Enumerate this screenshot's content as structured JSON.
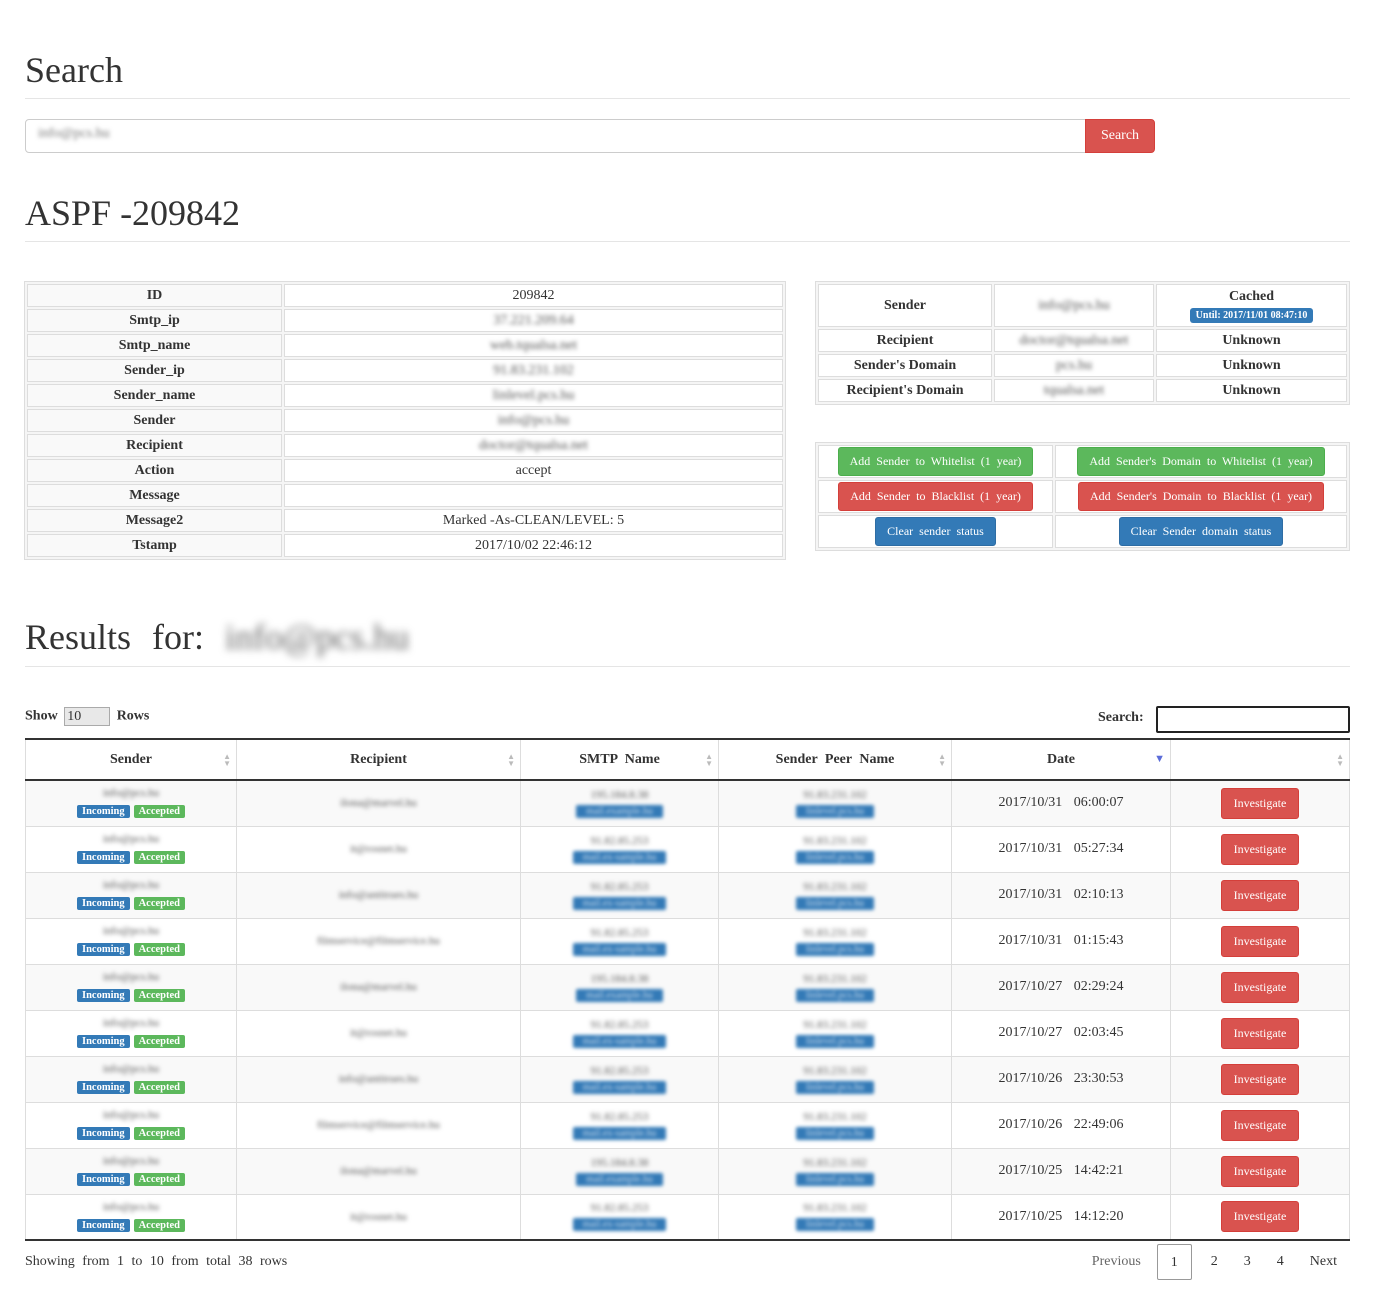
{
  "search": {
    "title": "Search",
    "input_value": "info@pcs.hu",
    "button_label": "Search"
  },
  "record": {
    "title": "ASPF -209842",
    "fields": [
      {
        "key": "ID",
        "value": "209842",
        "blurred": false
      },
      {
        "key": "Smtp_ip",
        "value": "37.221.209.64",
        "blurred": true
      },
      {
        "key": "Smtp_name",
        "value": "web.tqualsa.net",
        "blurred": true
      },
      {
        "key": "Sender_ip",
        "value": "91.83.231.102",
        "blurred": true
      },
      {
        "key": "Sender_name",
        "value": "linlevel.pcs.hu",
        "blurred": true
      },
      {
        "key": "Sender",
        "value": "info@pcs.hu",
        "blurred": true
      },
      {
        "key": "Recipient",
        "value": "doctor@tqualsa.net",
        "blurred": true
      },
      {
        "key": "Action",
        "value": "accept",
        "blurred": false
      },
      {
        "key": "Message",
        "value": "",
        "blurred": false
      },
      {
        "key": "Message2",
        "value": "Marked -As-CLEAN/LEVEL: 5",
        "blurred": false
      },
      {
        "key": "Tstamp",
        "value": "2017/10/02   22:46:12",
        "blurred": false
      }
    ]
  },
  "sender_status": {
    "rows": [
      {
        "label": "Sender",
        "value": "info@pcs.hu",
        "status": "Cached",
        "badge": "Until:  2017/11/01   08:47:10"
      },
      {
        "label": "Recipient",
        "value": "doctor@tqualsa.net",
        "status": "Unknown"
      },
      {
        "label": "Sender's   Domain",
        "value": "pcs.hu",
        "status": "Unknown"
      },
      {
        "label": "Recipient's   Domain",
        "value": "tqualsa.net",
        "status": "Unknown"
      }
    ]
  },
  "actions": {
    "whitelist_sender": "Add Sender  to Whitelist (1 year)",
    "whitelist_domain": "Add Sender's  Domain  to Whitelist (1 year)",
    "blacklist_sender": "Add Sender  to Blacklist (1 year)",
    "blacklist_domain": "Add Sender's  Domain  to Blacklist (1 year)",
    "clear_sender": "Clear  sender  status",
    "clear_domain": "Clear  Sender  domain  status"
  },
  "results": {
    "title": "Results   for:",
    "query": "info@pcs.hu",
    "show_label": "Show",
    "rows_value": "10",
    "rows_label": "Rows",
    "search_label": "Search:",
    "columns": [
      "Sender",
      "Recipient",
      "SMTP Name",
      "Sender  Peer  Name",
      "Date",
      ""
    ],
    "tag_incoming": "Incoming",
    "tag_accepted": "Accepted",
    "investigate_label": "Investigate",
    "rows": [
      {
        "sender": "info@pcs.hu",
        "recipient": "ilona@marvel.hu",
        "smtp_ip": "195.184.8.38",
        "smtp_name": "mail.example.hu",
        "peer_ip": "91.83.231.102",
        "peer_name": "linlevel.pcs.hu",
        "date": "2017/10/31   06:00:07"
      },
      {
        "sender": "info@pcs.hu",
        "recipient": "it@rosnet.hu",
        "smtp_ip": "91.82.85.253",
        "smtp_name": "mail.ex-sample.hu",
        "peer_ip": "91.83.231.102",
        "peer_name": "linlevel.pcs.hu",
        "date": "2017/10/31   05:27:34"
      },
      {
        "sender": "info@pcs.hu",
        "recipient": "info@antitrues.hu",
        "smtp_ip": "91.82.85.253",
        "smtp_name": "mail.ex-sample.hu",
        "peer_ip": "91.83.231.102",
        "peer_name": "linlevel.pcs.hu",
        "date": "2017/10/31   02:10:13"
      },
      {
        "sender": "info@pcs.hu",
        "recipient": "filmservice@filmservice.hu",
        "smtp_ip": "91.82.85.253",
        "smtp_name": "mail.ex-sample.hu",
        "peer_ip": "91.83.231.102",
        "peer_name": "linlevel.pcs.hu",
        "date": "2017/10/31   01:15:43"
      },
      {
        "sender": "info@pcs.hu",
        "recipient": "ilona@marvel.hu",
        "smtp_ip": "195.184.8.38",
        "smtp_name": "mail.example.hu",
        "peer_ip": "91.83.231.102",
        "peer_name": "linlevel.pcs.hu",
        "date": "2017/10/27   02:29:24"
      },
      {
        "sender": "info@pcs.hu",
        "recipient": "it@rosnet.hu",
        "smtp_ip": "91.82.85.253",
        "smtp_name": "mail.ex-sample.hu",
        "peer_ip": "91.83.231.102",
        "peer_name": "linlevel.pcs.hu",
        "date": "2017/10/27   02:03:45"
      },
      {
        "sender": "info@pcs.hu",
        "recipient": "info@antitrues.hu",
        "smtp_ip": "91.82.85.253",
        "smtp_name": "mail.ex-sample.hu",
        "peer_ip": "91.83.231.102",
        "peer_name": "linlevel.pcs.hu",
        "date": "2017/10/26   23:30:53"
      },
      {
        "sender": "info@pcs.hu",
        "recipient": "filmservice@filmservice.hu",
        "smtp_ip": "91.82.85.253",
        "smtp_name": "mail.ex-sample.hu",
        "peer_ip": "91.83.231.102",
        "peer_name": "linlevel.pcs.hu",
        "date": "2017/10/26   22:49:06"
      },
      {
        "sender": "info@pcs.hu",
        "recipient": "ilona@marvel.hu",
        "smtp_ip": "195.184.8.38",
        "smtp_name": "mail.example.hu",
        "peer_ip": "91.83.231.102",
        "peer_name": "linlevel.pcs.hu",
        "date": "2017/10/25   14:42:21"
      },
      {
        "sender": "info@pcs.hu",
        "recipient": "it@rosnet.hu",
        "smtp_ip": "91.82.85.253",
        "smtp_name": "mail.ex-sample.hu",
        "peer_ip": "91.83.231.102",
        "peer_name": "linlevel.pcs.hu",
        "date": "2017/10/25   14:12:20"
      }
    ],
    "footer_info": "Showing  from 1 to 10 from total 38 rows",
    "pager": {
      "previous": "Previous",
      "pages": [
        "1",
        "2",
        "3",
        "4"
      ],
      "current": "1",
      "next": "Next"
    }
  },
  "colors": {
    "danger": "#d9534f",
    "success": "#5cb85c",
    "primary": "#337ab7"
  }
}
